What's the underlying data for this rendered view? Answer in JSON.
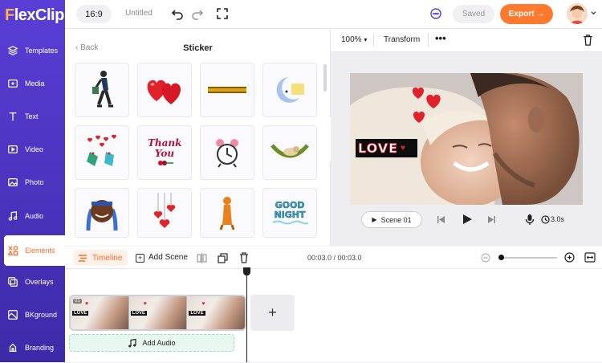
{
  "sidebar": {
    "brand": {
      "initial": "F",
      "rest": "lexClip"
    },
    "items": [
      {
        "label": "Templates",
        "icon": "layers-icon"
      },
      {
        "label": "Media",
        "icon": "media-icon"
      },
      {
        "label": "Text",
        "icon": "text-icon"
      },
      {
        "label": "Video",
        "icon": "video-icon"
      },
      {
        "label": "Photo",
        "icon": "photo-icon"
      },
      {
        "label": "Audio",
        "icon": "music-icon"
      },
      {
        "label": "Elements",
        "icon": "elements-icon",
        "active": true
      },
      {
        "label": "Overlays",
        "icon": "overlays-icon"
      },
      {
        "label": "BKground",
        "icon": "background-icon"
      },
      {
        "label": "Branding",
        "icon": "branding-icon"
      }
    ]
  },
  "topbar": {
    "ratio": "16:9",
    "project_title": "Untitled",
    "saved_label": "Saved",
    "export_label": "Export →"
  },
  "panel": {
    "back_label": "Back",
    "title": "Sticker",
    "stickers": [
      "walking-person-sticker",
      "red-hearts-sticker",
      "gold-banner-sticker",
      "moon-note-sticker",
      "hearts-cups-sticker",
      "thank-you-sticker",
      "alarm-clock-sticker",
      "hammock-sticker",
      "athlete-sticker",
      "hanging-hearts-sticker",
      "orange-figure-sticker",
      "good-night-sticker"
    ],
    "thank_you_text": "Thank You",
    "good_night_text": "GOOD NIGHT"
  },
  "preview": {
    "zoom": "100%",
    "transform_label": "Transform",
    "more_label": "•••",
    "love_text": "LOVE",
    "scene_label": "Scene 01",
    "duration": "3.0s"
  },
  "timeline": {
    "tab_label": "Timeline",
    "add_scene_label": "Add Scene",
    "timecode": "00:03.0 / 00:03.0",
    "clip_index": "01",
    "clip_love_text": "LOVE",
    "add_tile_label": "+",
    "add_audio_label": "Add Audio"
  },
  "colors": {
    "accent": "#ff7a2f",
    "sidebar_top": "#5a3ed6",
    "sidebar_bottom": "#3d2aa8",
    "heart": "#e0222c"
  }
}
